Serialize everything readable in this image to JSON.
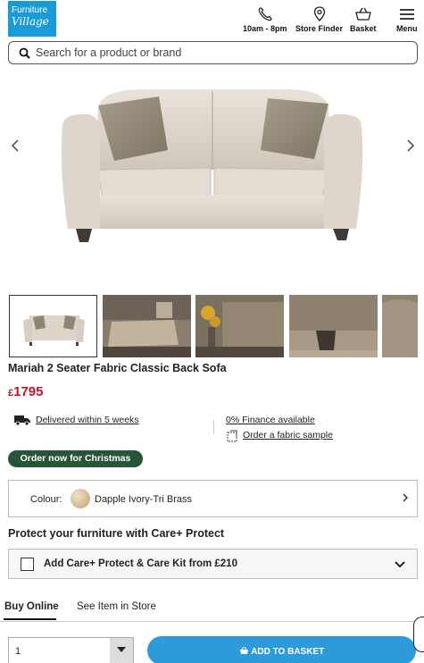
{
  "header": {
    "logo_line1": "Furniture",
    "logo_line2": "Village",
    "nav": [
      {
        "label": "10am - 8pm",
        "icon": "phone-icon"
      },
      {
        "label": "Store Finder",
        "icon": "location-pin-icon"
      },
      {
        "label": "Basket",
        "icon": "basket-icon"
      },
      {
        "label": "Menu",
        "icon": "hamburger-menu-icon"
      }
    ]
  },
  "search": {
    "placeholder": "Search for a product or brand"
  },
  "gallery": {
    "prev_icon": "chevron-left-icon",
    "next_icon": "chevron-right-icon"
  },
  "product": {
    "title": "Mariah 2 Seater Fabric Classic Back Sofa",
    "currency": "£",
    "price": "1795",
    "delivery_link": "Delivered within 5 weeks",
    "finance_link": "0% Finance available",
    "sample_link": "Order a fabric sample",
    "badge": "Order now for Christmas"
  },
  "colour": {
    "label": "Colour:",
    "value": "Dapple Ivory-Tri Brass"
  },
  "protect": {
    "heading": "Protect your furniture with Care+ Protect",
    "option": "Add Care+ Protect & Care Kit from £210"
  },
  "tabs": [
    "Buy Online",
    "See Item in Store"
  ],
  "purchase": {
    "quantity": "1",
    "add_button": "ADD TO BASKET"
  },
  "colors": {
    "brand_blue": "#1a9ad6",
    "price_red": "#c8102e",
    "badge_green": "#26553a",
    "button_blue": "#2d9bd9"
  }
}
